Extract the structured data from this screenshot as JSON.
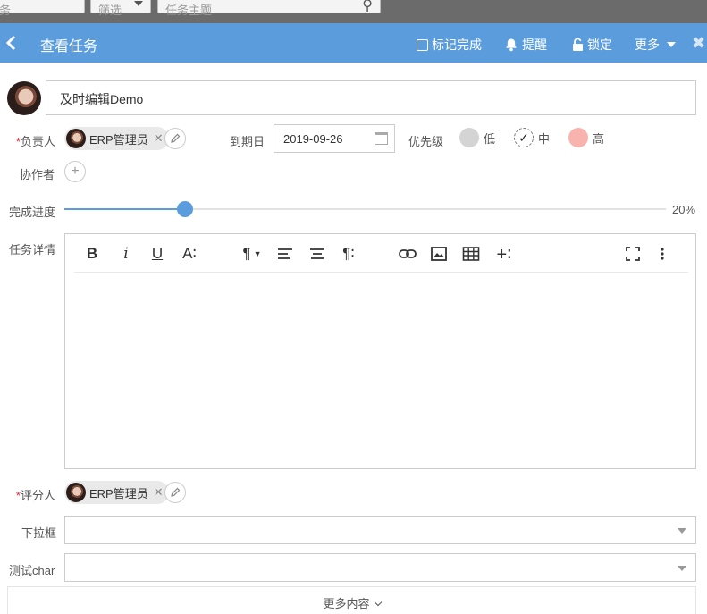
{
  "topbar": {
    "select1_value": "务",
    "select2_value": "筛选",
    "search_placeholder": "任务主题"
  },
  "header": {
    "title": "查看任务",
    "mark_done": "标记完成",
    "remind": "提醒",
    "lock": "锁定",
    "more": "更多"
  },
  "task": {
    "title": "及时编辑Demo"
  },
  "assignee": {
    "label": "负责人",
    "required": "*",
    "user": "ERP管理员"
  },
  "due": {
    "label": "到期日",
    "value": "2019-09-26"
  },
  "priority": {
    "label": "优先级",
    "options": [
      "低",
      "中",
      "高"
    ],
    "selected": "中"
  },
  "collaborators": {
    "label": "协作者"
  },
  "progress": {
    "label": "完成进度",
    "value": 20,
    "text": "20%"
  },
  "details": {
    "label": "任务详情"
  },
  "scorer": {
    "label": "评分人",
    "required": "*",
    "user": "ERP管理员"
  },
  "dropdown": {
    "label": "下拉框",
    "value": ""
  },
  "test_char": {
    "label": "测试char",
    "value": ""
  },
  "more_content": "更多内容",
  "colors": {
    "header": "#5b9ddc",
    "priority_low": "#d4d4d4",
    "priority_high": "#f8b3ae",
    "required": "#e23"
  }
}
